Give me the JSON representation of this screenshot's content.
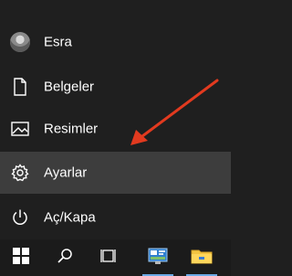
{
  "menu": {
    "items": [
      {
        "label": "Esra",
        "icon": "user-avatar-icon"
      },
      {
        "label": "Belgeler",
        "icon": "document-icon"
      },
      {
        "label": "Resimler",
        "icon": "image-icon"
      },
      {
        "label": "Ayarlar",
        "icon": "gear-icon",
        "active": true
      },
      {
        "label": "Aç/Kapa",
        "icon": "power-icon"
      }
    ]
  },
  "taskbar": {
    "items": [
      "windows-start-icon",
      "search-icon",
      "task-view-icon",
      "control-panel-app-icon",
      "file-explorer-icon"
    ]
  },
  "colors": {
    "menu_bg": "#1f1f1f",
    "active_bg": "#3d3d3d",
    "taskbar_bg": "#1b1b1b",
    "annotation_arrow": "#e23a1f",
    "running_indicator": "#6aa9e4"
  }
}
